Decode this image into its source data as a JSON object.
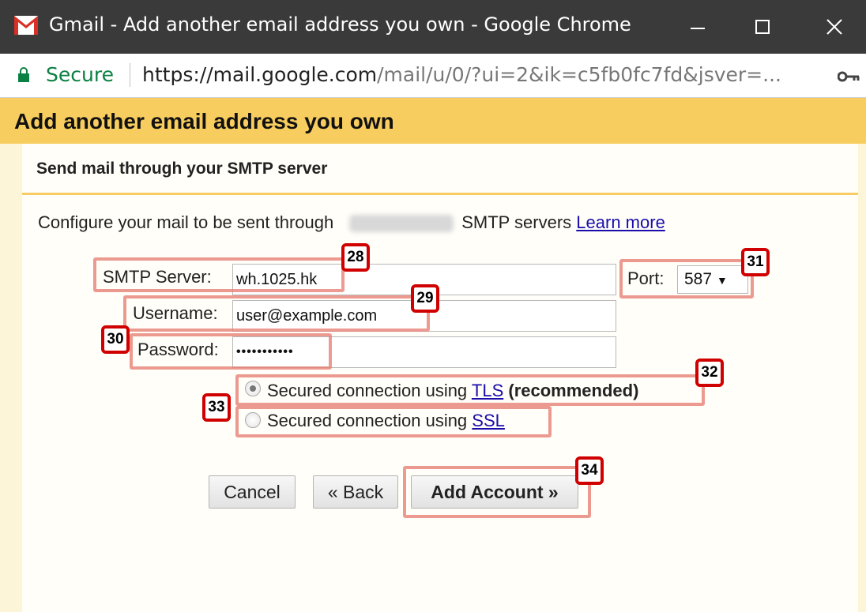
{
  "window": {
    "title": "Gmail - Add another email address you own - Google Chrome",
    "controls": [
      "minimize",
      "maximize",
      "close"
    ]
  },
  "addressbar": {
    "secure_label": "Secure",
    "url_host": "https://mail.google.com",
    "url_path": "/mail/u/0/?ui=2&ik=c5fb0fc7fd&jsver=..."
  },
  "page": {
    "title": "Add another email address you own",
    "section_heading": "Send mail through your SMTP server",
    "description_prefix": "Configure your mail to be sent through",
    "description_suffix": "SMTP servers",
    "learn_more": "Learn more"
  },
  "form": {
    "smtp_server_label": "SMTP Server:",
    "smtp_server_value": "wh.1025.hk",
    "port_label": "Port:",
    "port_value": "587",
    "username_label": "Username:",
    "username_value": "user@example.com",
    "password_label": "Password:",
    "password_value": "•••••••••••",
    "tls_prefix": "Secured connection using",
    "tls_link": "TLS",
    "tls_suffix": "(recommended)",
    "ssl_prefix": "Secured connection using",
    "ssl_link": "SSL",
    "tls_selected": true
  },
  "buttons": {
    "cancel": "Cancel",
    "back": "« Back",
    "add_account": "Add Account »"
  },
  "annotations": [
    "28",
    "29",
    "30",
    "31",
    "32",
    "33",
    "34"
  ],
  "colors": {
    "header_bg": "#f8cd5f",
    "page_bg": "#fdf5d7",
    "titlebar_bg": "#3a3a3a",
    "secure_green": "#0b8043",
    "badge_border": "#d00000",
    "highlight": "#e6786e"
  }
}
